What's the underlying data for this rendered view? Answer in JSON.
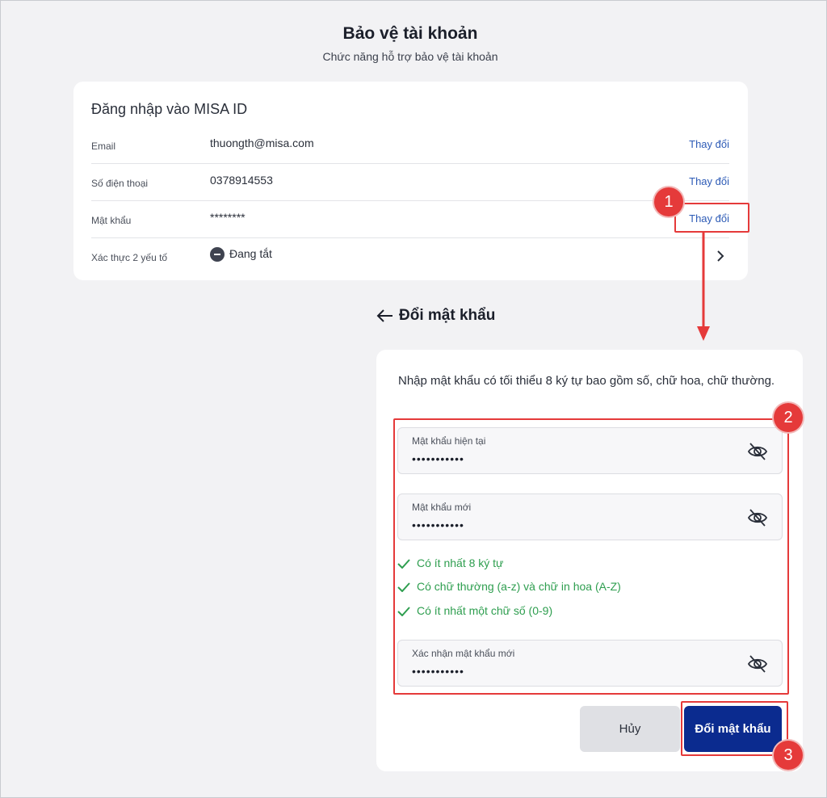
{
  "header": {
    "title": "Bảo vệ tài khoản",
    "subtitle": "Chức năng hỗ trợ bảo vệ tài khoản"
  },
  "login_card": {
    "title": "Đăng nhập vào MISA ID",
    "rows": [
      {
        "label": "Email",
        "value": "thuongth@misa.com",
        "action": "Thay đổi"
      },
      {
        "label": "Số điện thoại",
        "value": "0378914553",
        "action": "Thay đổi"
      },
      {
        "label": "Mật khẩu",
        "value": "********",
        "action": "Thay đổi"
      },
      {
        "label": "Xác thực 2 yếu tố",
        "value": "Đang tắt"
      }
    ]
  },
  "change_password": {
    "title": "Đổi mật khẩu",
    "description": "Nhập mật khẩu có tối thiểu 8 ký tự bao gồm số, chữ hoa, chữ thường.",
    "fields": [
      {
        "label": "Mật khẩu hiện tại",
        "value": "•••••••••••"
      },
      {
        "label": "Mật khẩu mới",
        "value": "•••••••••••"
      },
      {
        "label": "Xác nhận mật khẩu mới",
        "value": "•••••••••••"
      }
    ],
    "rules": [
      "Có ít nhất 8 ký tự",
      "Có chữ thường (a-z) và chữ in hoa (A-Z)",
      "Có ít nhất một chữ số (0-9)"
    ],
    "cancel_label": "Hủy",
    "submit_label": "Đổi mật khẩu"
  },
  "annotations": {
    "badge1": "1",
    "badge2": "2",
    "badge3": "3"
  },
  "colors": {
    "accent": "#0b2b8f",
    "link": "#2d5bb6",
    "success": "#2e9e4f",
    "annotation": "#e53a3a"
  }
}
